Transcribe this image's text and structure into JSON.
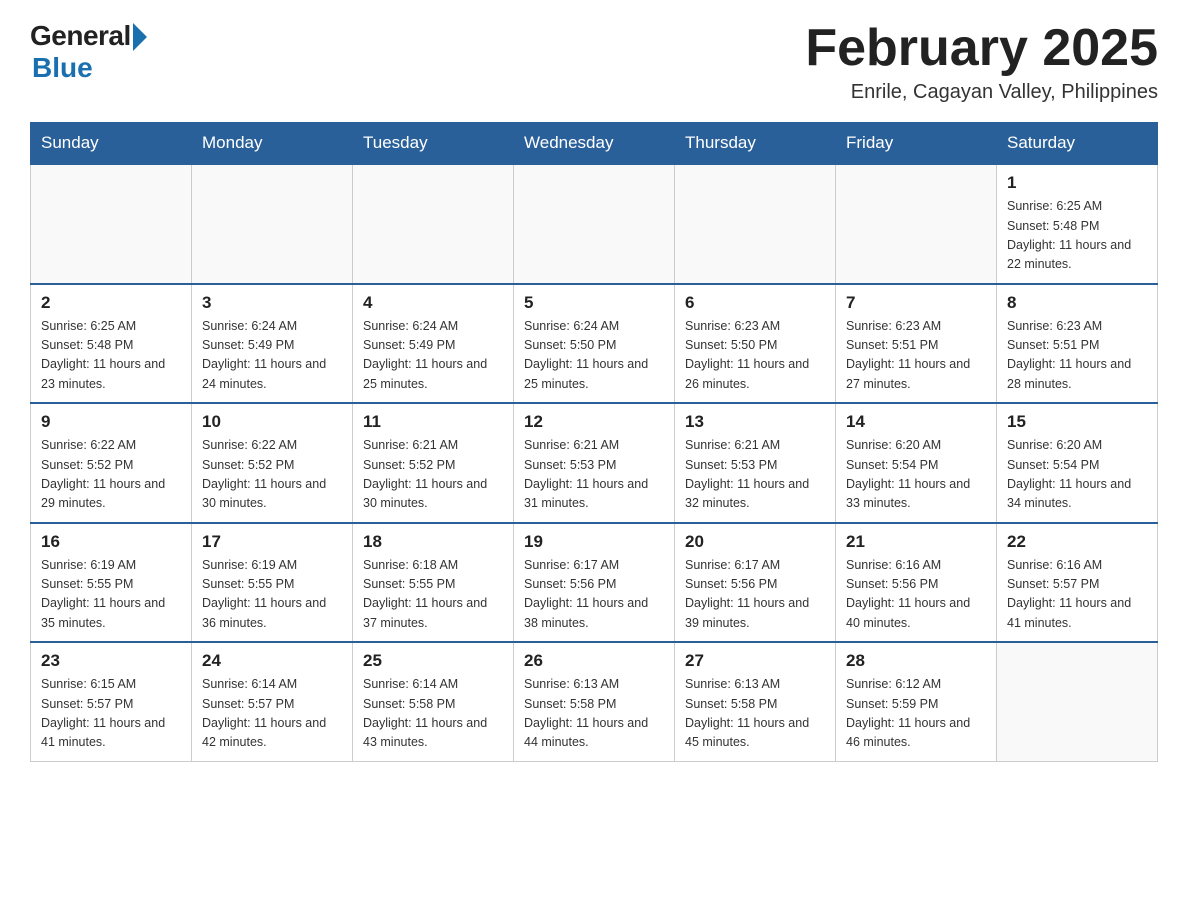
{
  "header": {
    "logo_general": "General",
    "logo_blue": "Blue",
    "month_title": "February 2025",
    "location": "Enrile, Cagayan Valley, Philippines"
  },
  "days_of_week": [
    "Sunday",
    "Monday",
    "Tuesday",
    "Wednesday",
    "Thursday",
    "Friday",
    "Saturday"
  ],
  "weeks": [
    [
      {
        "day": "",
        "info": ""
      },
      {
        "day": "",
        "info": ""
      },
      {
        "day": "",
        "info": ""
      },
      {
        "day": "",
        "info": ""
      },
      {
        "day": "",
        "info": ""
      },
      {
        "day": "",
        "info": ""
      },
      {
        "day": "1",
        "info": "Sunrise: 6:25 AM\nSunset: 5:48 PM\nDaylight: 11 hours and 22 minutes."
      }
    ],
    [
      {
        "day": "2",
        "info": "Sunrise: 6:25 AM\nSunset: 5:48 PM\nDaylight: 11 hours and 23 minutes."
      },
      {
        "day": "3",
        "info": "Sunrise: 6:24 AM\nSunset: 5:49 PM\nDaylight: 11 hours and 24 minutes."
      },
      {
        "day": "4",
        "info": "Sunrise: 6:24 AM\nSunset: 5:49 PM\nDaylight: 11 hours and 25 minutes."
      },
      {
        "day": "5",
        "info": "Sunrise: 6:24 AM\nSunset: 5:50 PM\nDaylight: 11 hours and 25 minutes."
      },
      {
        "day": "6",
        "info": "Sunrise: 6:23 AM\nSunset: 5:50 PM\nDaylight: 11 hours and 26 minutes."
      },
      {
        "day": "7",
        "info": "Sunrise: 6:23 AM\nSunset: 5:51 PM\nDaylight: 11 hours and 27 minutes."
      },
      {
        "day": "8",
        "info": "Sunrise: 6:23 AM\nSunset: 5:51 PM\nDaylight: 11 hours and 28 minutes."
      }
    ],
    [
      {
        "day": "9",
        "info": "Sunrise: 6:22 AM\nSunset: 5:52 PM\nDaylight: 11 hours and 29 minutes."
      },
      {
        "day": "10",
        "info": "Sunrise: 6:22 AM\nSunset: 5:52 PM\nDaylight: 11 hours and 30 minutes."
      },
      {
        "day": "11",
        "info": "Sunrise: 6:21 AM\nSunset: 5:52 PM\nDaylight: 11 hours and 30 minutes."
      },
      {
        "day": "12",
        "info": "Sunrise: 6:21 AM\nSunset: 5:53 PM\nDaylight: 11 hours and 31 minutes."
      },
      {
        "day": "13",
        "info": "Sunrise: 6:21 AM\nSunset: 5:53 PM\nDaylight: 11 hours and 32 minutes."
      },
      {
        "day": "14",
        "info": "Sunrise: 6:20 AM\nSunset: 5:54 PM\nDaylight: 11 hours and 33 minutes."
      },
      {
        "day": "15",
        "info": "Sunrise: 6:20 AM\nSunset: 5:54 PM\nDaylight: 11 hours and 34 minutes."
      }
    ],
    [
      {
        "day": "16",
        "info": "Sunrise: 6:19 AM\nSunset: 5:55 PM\nDaylight: 11 hours and 35 minutes."
      },
      {
        "day": "17",
        "info": "Sunrise: 6:19 AM\nSunset: 5:55 PM\nDaylight: 11 hours and 36 minutes."
      },
      {
        "day": "18",
        "info": "Sunrise: 6:18 AM\nSunset: 5:55 PM\nDaylight: 11 hours and 37 minutes."
      },
      {
        "day": "19",
        "info": "Sunrise: 6:17 AM\nSunset: 5:56 PM\nDaylight: 11 hours and 38 minutes."
      },
      {
        "day": "20",
        "info": "Sunrise: 6:17 AM\nSunset: 5:56 PM\nDaylight: 11 hours and 39 minutes."
      },
      {
        "day": "21",
        "info": "Sunrise: 6:16 AM\nSunset: 5:56 PM\nDaylight: 11 hours and 40 minutes."
      },
      {
        "day": "22",
        "info": "Sunrise: 6:16 AM\nSunset: 5:57 PM\nDaylight: 11 hours and 41 minutes."
      }
    ],
    [
      {
        "day": "23",
        "info": "Sunrise: 6:15 AM\nSunset: 5:57 PM\nDaylight: 11 hours and 41 minutes."
      },
      {
        "day": "24",
        "info": "Sunrise: 6:14 AM\nSunset: 5:57 PM\nDaylight: 11 hours and 42 minutes."
      },
      {
        "day": "25",
        "info": "Sunrise: 6:14 AM\nSunset: 5:58 PM\nDaylight: 11 hours and 43 minutes."
      },
      {
        "day": "26",
        "info": "Sunrise: 6:13 AM\nSunset: 5:58 PM\nDaylight: 11 hours and 44 minutes."
      },
      {
        "day": "27",
        "info": "Sunrise: 6:13 AM\nSunset: 5:58 PM\nDaylight: 11 hours and 45 minutes."
      },
      {
        "day": "28",
        "info": "Sunrise: 6:12 AM\nSunset: 5:59 PM\nDaylight: 11 hours and 46 minutes."
      },
      {
        "day": "",
        "info": ""
      }
    ]
  ]
}
